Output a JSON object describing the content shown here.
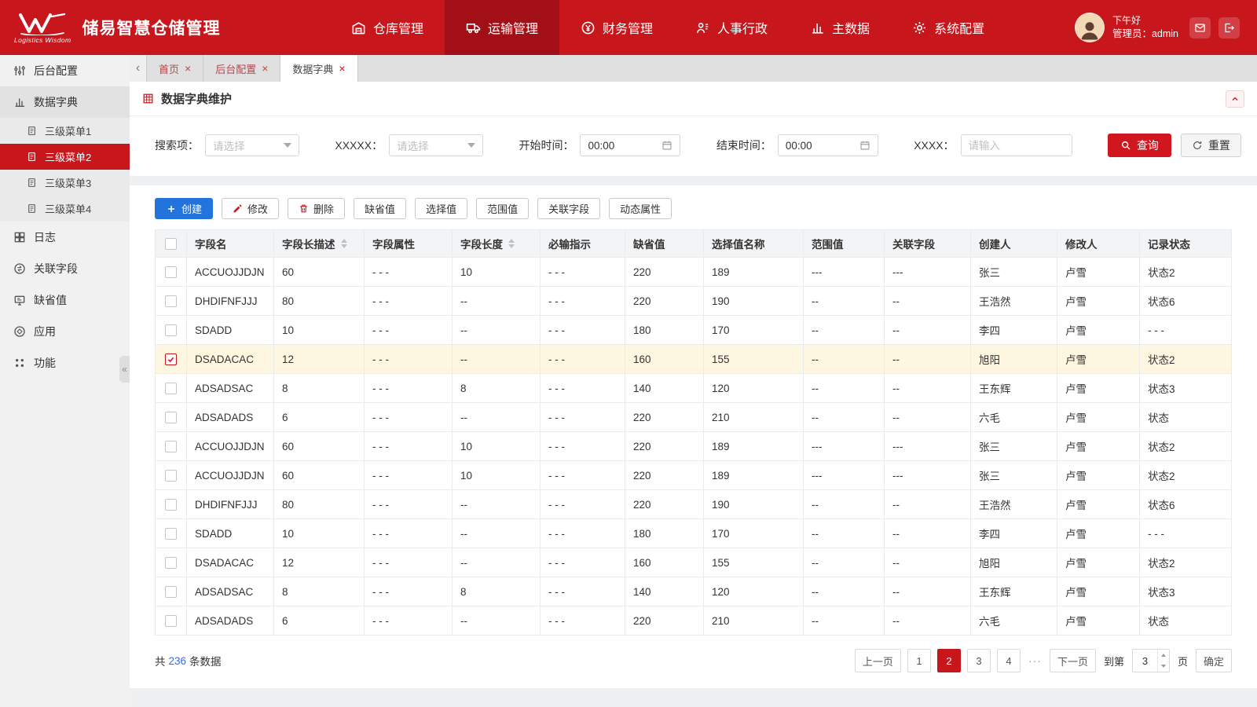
{
  "app": {
    "title": "储易智慧仓储管理",
    "logo_sub": "Logistics Wisdom"
  },
  "colors": {
    "brand_red": "#c8161d",
    "nav_active_red": "#a30f16",
    "query_red": "#d0171f",
    "primary_blue": "#2273dc",
    "selected_row_yellow": "#fdf6e0",
    "link_blue": "#2e6cf2"
  },
  "icons": {
    "close-icon": "×",
    "back-icon": "‹",
    "collapse-icon": "«"
  },
  "header": {
    "nav": [
      {
        "label": "仓库管理",
        "icon": "warehouse-icon",
        "active": false
      },
      {
        "label": "运输管理",
        "icon": "truck-icon",
        "active": true
      },
      {
        "label": "财务管理",
        "icon": "finance-icon",
        "active": false
      },
      {
        "label": "人事行政",
        "icon": "hr-icon",
        "active": false
      },
      {
        "label": "主数据",
        "icon": "masterdata-icon",
        "active": false
      },
      {
        "label": "系统配置",
        "icon": "gear-icon",
        "active": false
      }
    ],
    "user": {
      "greeting": "下午好",
      "role_line": "管理员：admin"
    }
  },
  "sidebar": {
    "items": [
      {
        "label": "后台配置",
        "icon": "sliders-icon",
        "type": "top",
        "active": false
      },
      {
        "label": "数据字典",
        "icon": "dict-icon",
        "type": "top",
        "active": true
      },
      {
        "label": "三级菜单1",
        "icon": "doc-icon",
        "type": "sub",
        "active": false
      },
      {
        "label": "三级菜单2",
        "icon": "doc-icon",
        "type": "sub",
        "active": true
      },
      {
        "label": "三级菜单3",
        "icon": "doc-icon",
        "type": "sub",
        "active": false
      },
      {
        "label": "三级菜单4",
        "icon": "doc-icon",
        "type": "sub",
        "active": false
      },
      {
        "label": "日志",
        "icon": "log-icon",
        "type": "top",
        "active": false
      },
      {
        "label": "关联字段",
        "icon": "link-icon",
        "type": "top",
        "active": false
      },
      {
        "label": "缺省值",
        "icon": "default-icon",
        "type": "top",
        "active": false
      },
      {
        "label": "应用",
        "icon": "app-icon",
        "type": "top",
        "active": false
      },
      {
        "label": "功能",
        "icon": "feature-icon",
        "type": "top",
        "active": false
      }
    ]
  },
  "tabs": [
    {
      "label": "首页",
      "active": false
    },
    {
      "label": "后台配置",
      "active": false
    },
    {
      "label": "数据字典",
      "active": true
    }
  ],
  "panel": {
    "title": "数据字典维护"
  },
  "filters": {
    "search_label": "搜索项：",
    "search_placeholder": "请选择",
    "xxxxx_label": "XXXXX：",
    "xxxxx_placeholder": "请选择",
    "start_label": "开始时间：",
    "start_value": "00:00",
    "end_label": "结束时间：",
    "end_value": "00:00",
    "xxxx_label": "XXXX：",
    "xxxx_placeholder": "请输入",
    "query_button": "查询",
    "reset_button": "重置"
  },
  "toolbar": [
    {
      "label": "创建",
      "icon": "plus-icon",
      "style": "primary"
    },
    {
      "label": "修改",
      "icon": "pencil-icon",
      "style": "default"
    },
    {
      "label": "删除",
      "icon": "trash-icon",
      "style": "default"
    },
    {
      "label": "缺省值",
      "style": "default"
    },
    {
      "label": "选择值",
      "style": "default"
    },
    {
      "label": "范围值",
      "style": "default"
    },
    {
      "label": "关联字段",
      "style": "default"
    },
    {
      "label": "动态属性",
      "style": "default"
    }
  ],
  "table": {
    "columns": [
      {
        "label": "字段名",
        "sortable": false
      },
      {
        "label": "字段长描述",
        "sortable": true
      },
      {
        "label": "字段属性",
        "sortable": false
      },
      {
        "label": "字段长度",
        "sortable": true
      },
      {
        "label": "必输指示",
        "sortable": false
      },
      {
        "label": "缺省值",
        "sortable": false
      },
      {
        "label": "选择值名称",
        "sortable": false
      },
      {
        "label": "范围值",
        "sortable": false
      },
      {
        "label": "关联字段",
        "sortable": false
      },
      {
        "label": "创建人",
        "sortable": false
      },
      {
        "label": "修改人",
        "sortable": false
      },
      {
        "label": "记录状态",
        "sortable": false
      }
    ],
    "rows": [
      {
        "checked": false,
        "cells": [
          "ACCUOJJDJN",
          "60",
          "- - -",
          "10",
          "- - -",
          "220",
          "189",
          "---",
          "---",
          "张三",
          "卢雪",
          "状态2"
        ]
      },
      {
        "checked": false,
        "cells": [
          "DHDIFNFJJJ",
          "80",
          "- - -",
          "--",
          "- - -",
          "220",
          "190",
          "--",
          "--",
          "王浩然",
          "卢雪",
          "状态6"
        ]
      },
      {
        "checked": false,
        "cells": [
          "SDADD",
          "10",
          "- - -",
          "--",
          "- - -",
          "180",
          "170",
          "--",
          "--",
          "李四",
          "卢雪",
          "- - -"
        ]
      },
      {
        "checked": true,
        "cells": [
          "DSADACAC",
          "12",
          "- - -",
          "--",
          "- - -",
          "160",
          "155",
          "--",
          "--",
          "旭阳",
          "卢雪",
          "状态2"
        ]
      },
      {
        "checked": false,
        "cells": [
          "ADSADSAC",
          "8",
          "- - -",
          "8",
          "- - -",
          "140",
          "120",
          "--",
          "--",
          "王东辉",
          "卢雪",
          "状态3"
        ]
      },
      {
        "checked": false,
        "cells": [
          "ADSADADS",
          "6",
          "- - -",
          "--",
          "- - -",
          "220",
          "210",
          "--",
          "--",
          "六毛",
          "卢雪",
          "状态"
        ]
      },
      {
        "checked": false,
        "cells": [
          "ACCUOJJDJN",
          "60",
          "- - -",
          "10",
          "- - -",
          "220",
          "189",
          "---",
          "---",
          "张三",
          "卢雪",
          "状态2"
        ]
      },
      {
        "checked": false,
        "cells": [
          "ACCUOJJDJN",
          "60",
          "- - -",
          "10",
          "- - -",
          "220",
          "189",
          "---",
          "---",
          "张三",
          "卢雪",
          "状态2"
        ]
      },
      {
        "checked": false,
        "cells": [
          "DHDIFNFJJJ",
          "80",
          "- - -",
          "--",
          "- - -",
          "220",
          "190",
          "--",
          "--",
          "王浩然",
          "卢雪",
          "状态6"
        ]
      },
      {
        "checked": false,
        "cells": [
          "SDADD",
          "10",
          "- - -",
          "--",
          "- - -",
          "180",
          "170",
          "--",
          "--",
          "李四",
          "卢雪",
          "- - -"
        ]
      },
      {
        "checked": false,
        "cells": [
          "DSADACAC",
          "12",
          "- - -",
          "--",
          "- - -",
          "160",
          "155",
          "--",
          "--",
          "旭阳",
          "卢雪",
          "状态2"
        ]
      },
      {
        "checked": false,
        "cells": [
          "ADSADSAC",
          "8",
          "- - -",
          "8",
          "- - -",
          "140",
          "120",
          "--",
          "--",
          "王东辉",
          "卢雪",
          "状态3"
        ]
      },
      {
        "checked": false,
        "cells": [
          "ADSADADS",
          "6",
          "- - -",
          "--",
          "- - -",
          "220",
          "210",
          "--",
          "--",
          "六毛",
          "卢雪",
          "状态"
        ]
      }
    ]
  },
  "footer": {
    "total_prefix": "共",
    "total_count": "236",
    "total_suffix": "条数据",
    "pagination": {
      "prev": "上一页",
      "pages": [
        "1",
        "2",
        "3",
        "4"
      ],
      "active_page": "2",
      "ellipsis": "···",
      "next": "下一页",
      "goto_prefix": "到第",
      "goto_value": "3",
      "goto_suffix": "页",
      "confirm": "确定"
    }
  }
}
